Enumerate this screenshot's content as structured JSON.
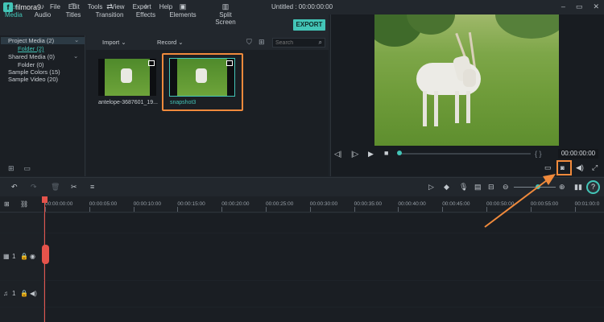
{
  "app": {
    "logo_text": "filmora9",
    "title": "Untitled : 00:00:00:00"
  },
  "menu": [
    "File",
    "Edit",
    "Tools",
    "View",
    "Export",
    "Help"
  ],
  "window_buttons": [
    "–",
    "▭",
    "✕"
  ],
  "media_tabs": [
    {
      "label": "Media",
      "icon": "folder-icon"
    },
    {
      "label": "Audio",
      "icon": "music-note-icon"
    },
    {
      "label": "Titles",
      "icon": "text-icon"
    },
    {
      "label": "Transition",
      "icon": "transition-icon"
    },
    {
      "label": "Effects",
      "icon": "effects-icon"
    },
    {
      "label": "Elements",
      "icon": "image-icon"
    },
    {
      "label": "Split Screen",
      "icon": "split-screen-icon"
    }
  ],
  "export_label": "EXPORT",
  "library": {
    "items": [
      {
        "label": "Project Media (2)"
      },
      {
        "label": "Folder (2)"
      },
      {
        "label": "Shared Media (0)"
      },
      {
        "label": "Folder (0)"
      },
      {
        "label": "Sample Colors (15)"
      },
      {
        "label": "Sample Video (20)"
      }
    ]
  },
  "bin": {
    "import_label": "Import",
    "record_label": "Record",
    "search_placeholder": "Search",
    "clips": [
      {
        "label": "antelope-3687601_19..."
      },
      {
        "label": "snapshot3"
      }
    ]
  },
  "preview": {
    "timecode": "00:00:00:00",
    "bracket_label": "{   }"
  },
  "ruler": {
    "ticks": [
      "00:00:00:00",
      "00:00:05:00",
      "00:00:10:00",
      "00:00:15:00",
      "00:00:20:00",
      "00:00:25:00",
      "00:00:30:00",
      "00:00:35:00",
      "00:00:40:00",
      "00:00:45:00",
      "00:00:50:00",
      "00:00:55:00",
      "00:01:00:0"
    ]
  },
  "tracks": {
    "video_label": "1",
    "audio_label": "1"
  },
  "colors": {
    "accent": "#43c5b7",
    "highlight": "#f08a3c",
    "playhead": "#e5534b"
  }
}
